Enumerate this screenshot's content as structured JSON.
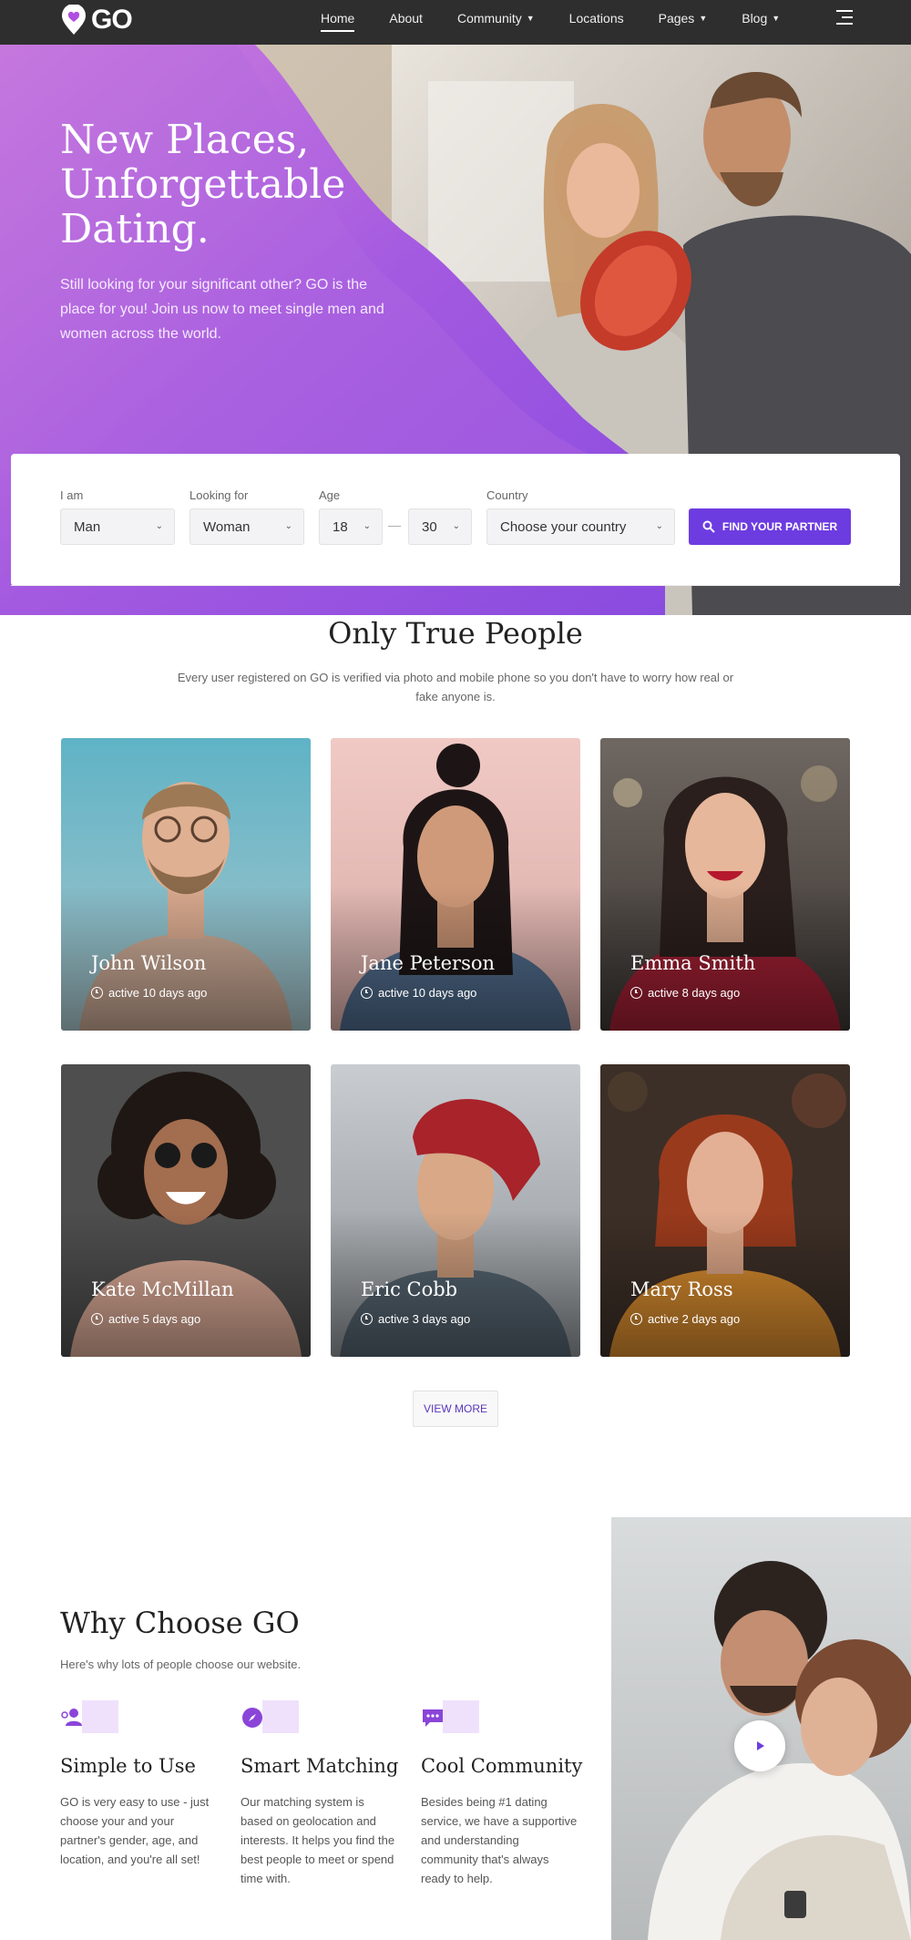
{
  "nav": {
    "logo_text": "GO",
    "links": [
      {
        "label": "Home",
        "active": true,
        "dropdown": false
      },
      {
        "label": "About",
        "active": false,
        "dropdown": false
      },
      {
        "label": "Community",
        "active": false,
        "dropdown": true
      },
      {
        "label": "Locations",
        "active": false,
        "dropdown": false
      },
      {
        "label": "Pages",
        "active": false,
        "dropdown": true
      },
      {
        "label": "Blog",
        "active": false,
        "dropdown": true
      }
    ]
  },
  "hero": {
    "title": "New Places, Unforgettable Dating.",
    "subtitle": "Still looking for your significant other? GO is the place for you! Join us now to meet single men and women across the world."
  },
  "search": {
    "i_am_label": "I am",
    "i_am_value": "Man",
    "looking_for_label": "Looking for",
    "looking_for_value": "Woman",
    "age_label": "Age",
    "age_min": "18",
    "age_max": "30",
    "age_separator": "—",
    "country_label": "Country",
    "country_value": "Choose your country",
    "button_label": "FIND YOUR PARTNER"
  },
  "people": {
    "title": "Only True People",
    "description": "Every user registered on GO is verified via photo and mobile phone so you don't have to worry how real or fake anyone is.",
    "cards": [
      {
        "name": "John Wilson",
        "active": "active 10 days ago"
      },
      {
        "name": "Jane Peterson",
        "active": "active 10 days ago"
      },
      {
        "name": "Emma Smith",
        "active": "active 8 days ago"
      },
      {
        "name": "Kate McMillan",
        "active": "active 5 days ago"
      },
      {
        "name": "Eric Cobb",
        "active": "active 3 days ago"
      },
      {
        "name": "Mary Ross",
        "active": "active 2 days ago"
      }
    ],
    "view_more": "VIEW MORE"
  },
  "why": {
    "title": "Why Choose GO",
    "subtitle": "Here's why lots of people choose our website.",
    "features": [
      {
        "title": "Simple to Use",
        "text": "GO is very easy to use - just choose your and your partner's gender, age, and location, and you're all set!",
        "icon": "user-icon"
      },
      {
        "title": "Smart Matching",
        "text": "Our matching system is based on geolocation and interests. It helps you find the best people to meet or spend time with.",
        "icon": "compass-icon"
      },
      {
        "title": "Cool Community",
        "text": "Besides being #1 dating service, we have a supportive and understanding community that's always ready to help.",
        "icon": "chat-icon"
      }
    ]
  },
  "colors": {
    "accent": "#6d3ce0",
    "nav_bg": "#2e2e2e",
    "hero_purple": "#a65ce0",
    "icon_tint": "#efe1fb"
  }
}
